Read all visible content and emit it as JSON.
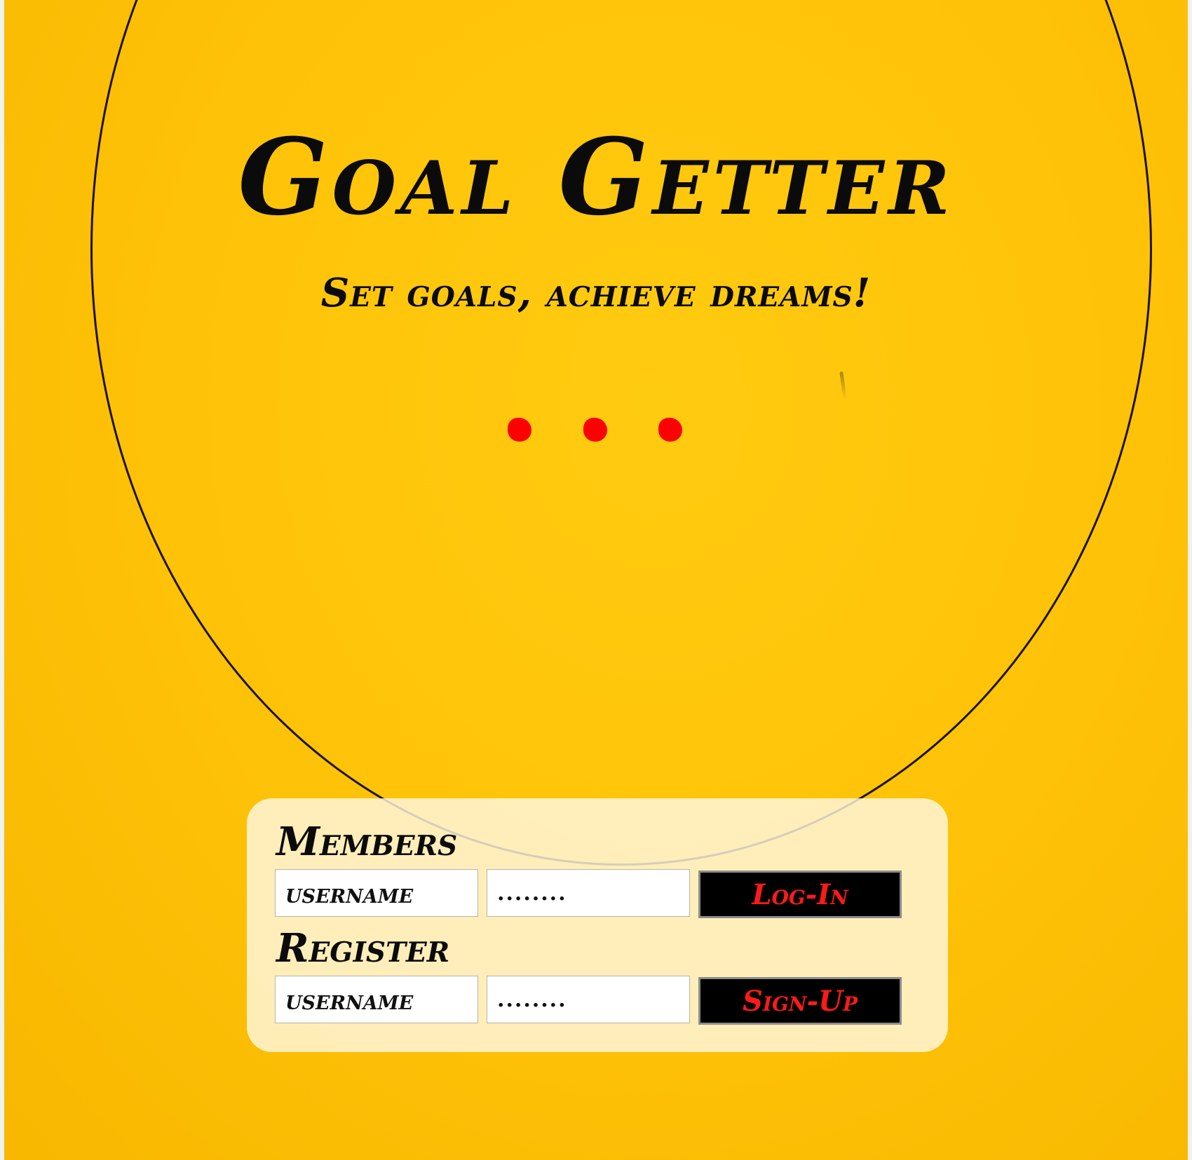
{
  "header": {
    "title": "Goal Getter",
    "tagline": "Set goals, achieve dreams!"
  },
  "colors": {
    "background": "#ffc40a",
    "accent": "#ff0000",
    "panel": "#fff8e1",
    "button": "#000000"
  },
  "login": {
    "heading": "Members",
    "username_placeholder": "username",
    "password_value": "........",
    "submit_label": "Log-In"
  },
  "register": {
    "heading": "Register",
    "username_placeholder": "username",
    "password_value": "........",
    "submit_label": "Sign-Up"
  }
}
